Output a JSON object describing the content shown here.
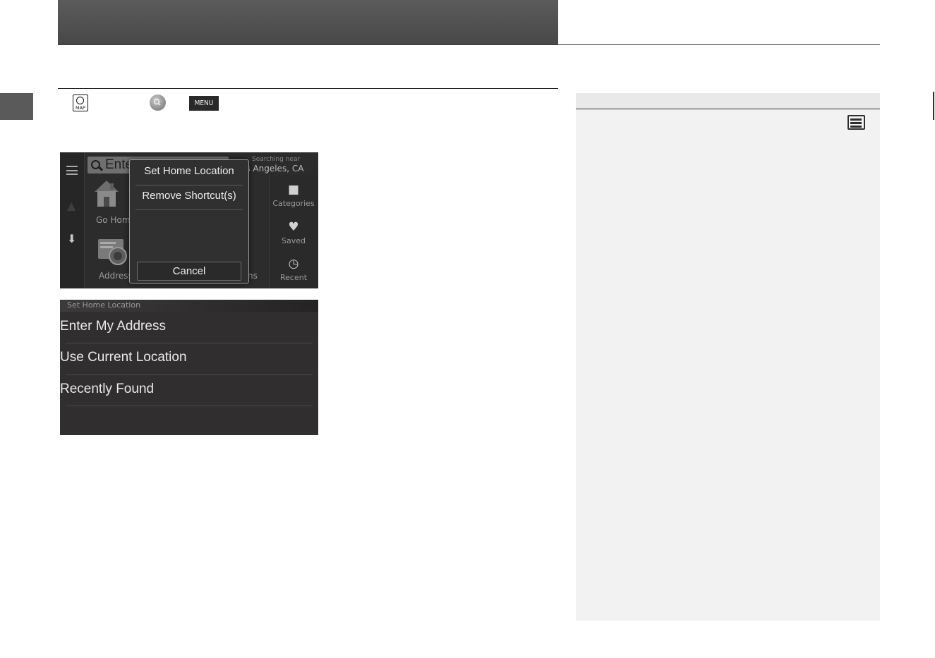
{
  "steps": {
    "map_icon_label": "MAP",
    "menu_button_label": "MENU"
  },
  "screen1": {
    "search_placeholder": "Ente",
    "searching_near_label": "Searching near",
    "searching_near_city": "os Angeles, CA",
    "shortcuts": [
      {
        "label": "Go Hom"
      },
      {
        "label": "Address"
      },
      {
        "label": "ns"
      }
    ],
    "rail": [
      {
        "label": "Categories",
        "icon": "speech-bubble-icon"
      },
      {
        "label": "Saved",
        "icon": "heart-icon"
      },
      {
        "label": "Recent",
        "icon": "clock-icon"
      }
    ],
    "popup": {
      "options": [
        "Set Home Location",
        "Remove Shortcut(s)"
      ],
      "cancel_label": "Cancel"
    }
  },
  "screen2": {
    "title": "Set Home Location",
    "options": [
      "Enter My Address",
      "Use Current Location",
      "Recently Found"
    ]
  },
  "colors": {
    "header_band": "#505050",
    "side_panel": "#f2f2f2",
    "screen_bg": "#2c2c2c"
  }
}
